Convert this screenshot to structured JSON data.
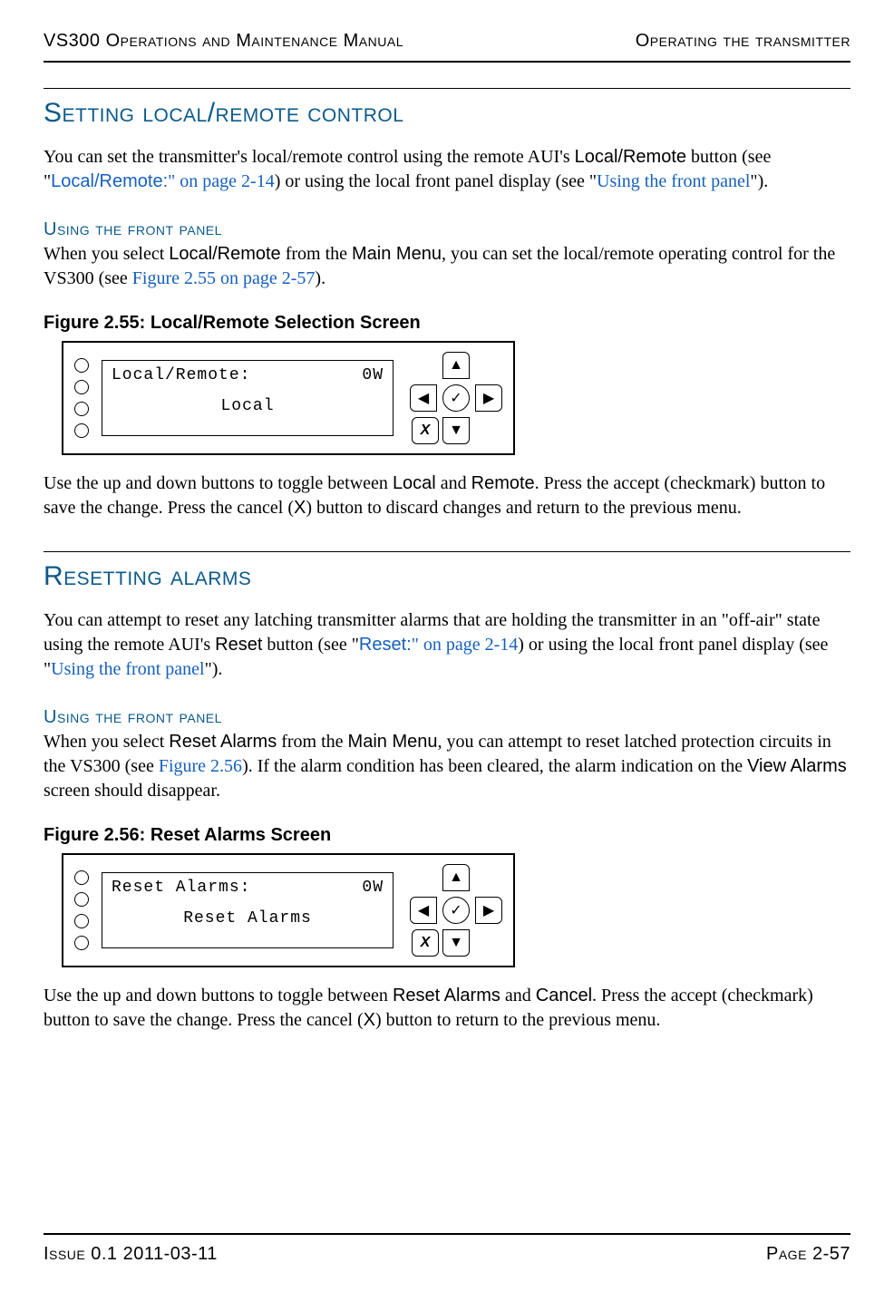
{
  "header": {
    "left": "VS300 Operations and Maintenance Manual",
    "right": "Operating the transmitter"
  },
  "section1": {
    "title": "Setting local/remote control",
    "p1_a": "You can set the transmitter's local/remote control using the remote AUI's ",
    "p1_b": "Local/Remote",
    "p1_c": " button (see \"",
    "p1_link1": "Local/Remote:",
    "p1_link1b": "\" on page 2-14",
    "p1_d": ") or using the local front panel display (see \"",
    "p1_link2": "Using the front panel",
    "p1_e": "\").",
    "sub": "Using the front panel",
    "p2_a": "When you select ",
    "p2_b": "Local/Remote",
    "p2_c": " from the ",
    "p2_d": "Main Menu",
    "p2_e": ", you can set the local/remote operating control for the VS300 (see ",
    "p2_link": "Figure 2.55 on page 2-57",
    "p2_f": ").",
    "fig_caption": "Figure 2.55: Local/Remote Selection Screen",
    "lcd": {
      "line1_left": "Local/Remote:",
      "line1_right": "0W",
      "line2": "Local"
    },
    "p3_a": "Use the up and down buttons to toggle between ",
    "p3_b": "Local",
    "p3_c": " and ",
    "p3_d": "Remote",
    "p3_e": ". Press the accept (checkmark) button to save the change. Press the cancel (",
    "p3_f": "X",
    "p3_g": ") button to discard changes and return to the previous menu."
  },
  "section2": {
    "title": "Resetting alarms",
    "p1_a": "You can attempt to reset any latching transmitter alarms that are holding the transmitter in an \"off-air\" state using the remote AUI's ",
    "p1_b": "Reset",
    "p1_c": " button (see \"",
    "p1_link1": "Reset:",
    "p1_link1b": "\" on page 2-14",
    "p1_d": ") or using the local front panel display (see \"",
    "p1_link2": "Using the front panel",
    "p1_e": "\").",
    "sub": "Using the front panel",
    "p2_a": "When you select ",
    "p2_b": "Reset Alarms",
    "p2_c": " from the ",
    "p2_d": "Main Menu",
    "p2_e": ", you can attempt to reset latched protection circuits in the VS300 (see ",
    "p2_link": "Figure 2.56",
    "p2_f": "). If the alarm condition has been cleared, the alarm indication on the ",
    "p2_g": "View Alarms",
    "p2_h": " screen should disappear.",
    "fig_caption": "Figure 2.56: Reset Alarms Screen",
    "lcd": {
      "line1_left": "Reset Alarms:",
      "line1_right": "0W",
      "line2": "Reset Alarms"
    },
    "p3_a": "Use the up and down buttons to toggle between ",
    "p3_b": "Reset Alarms",
    "p3_c": " and ",
    "p3_d": "Cancel",
    "p3_e": ". Press the accept (checkmark) button to save the change. Press the cancel (",
    "p3_f": "X",
    "p3_g": ") button to return to the previous menu."
  },
  "dpad": {
    "up": "▲",
    "down": "▼",
    "left": "◀",
    "right": "▶",
    "ok": "✓",
    "x": "X"
  },
  "footer": {
    "left": "Issue 0.1  2011-03-11",
    "right": "Page 2-57"
  }
}
